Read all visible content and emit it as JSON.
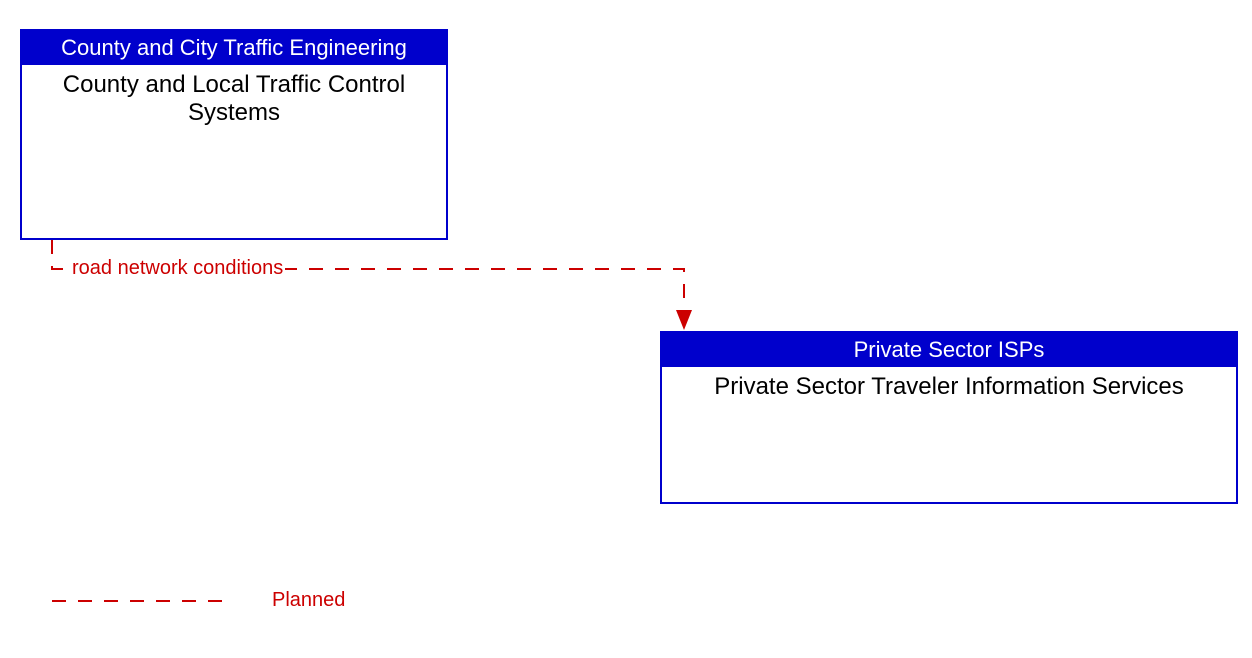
{
  "nodes": {
    "source": {
      "header": "County and City Traffic Engineering",
      "body": "County and Local Traffic Control Systems",
      "headerBg": "#0000cc"
    },
    "target": {
      "header": "Private Sector ISPs",
      "body": "Private Sector Traveler Information Services",
      "headerBg": "#0000cc"
    }
  },
  "flows": {
    "label": "road network conditions",
    "color": "#cc0000"
  },
  "legend": {
    "label": "Planned",
    "color": "#cc0000"
  }
}
